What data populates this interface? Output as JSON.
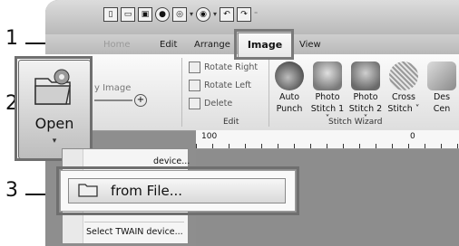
{
  "title_bar": {
    "quick_access_icons": [
      "new-icon",
      "open-icon",
      "save-icon",
      "record-icon",
      "view-icon",
      "circle-icon",
      "undo-icon",
      "redo-icon"
    ]
  },
  "tabs": [
    {
      "label": "Home",
      "active": false
    },
    {
      "label": "Edit",
      "active": false
    },
    {
      "label": "Arrange",
      "active": false
    },
    {
      "label": "Image",
      "active": true
    },
    {
      "label": "View",
      "active": false
    }
  ],
  "ribbon": {
    "open_label": "Open",
    "image_label": "y Image",
    "edit_group": {
      "label": "Edit",
      "rotate_right": "Rotate Right",
      "rotate_left": "Rotate Left",
      "delete": "Delete"
    },
    "stitch_wizard": {
      "label": "Stitch Wizard",
      "buttons": [
        {
          "line1": "Auto",
          "line2": "Punch"
        },
        {
          "line1": "Photo",
          "line2": "Stitch 1 ˅"
        },
        {
          "line1": "Photo",
          "line2": "Stitch 2 ˅"
        },
        {
          "line1": "Cross",
          "line2": "Stitch ˅"
        },
        {
          "line1": "Des",
          "line2": "Cen"
        }
      ]
    }
  },
  "ruler": {
    "mark_100": "100",
    "mark_0": "0"
  },
  "menu": {
    "item_device": "device...",
    "item_from_file": "from File...",
    "item_twain": "Select TWAIN device..."
  },
  "callouts": [
    "1",
    "2",
    "3"
  ],
  "colors": {
    "highlight_outline": "#6f6f6f",
    "window_gray": "#8e8e8e"
  }
}
